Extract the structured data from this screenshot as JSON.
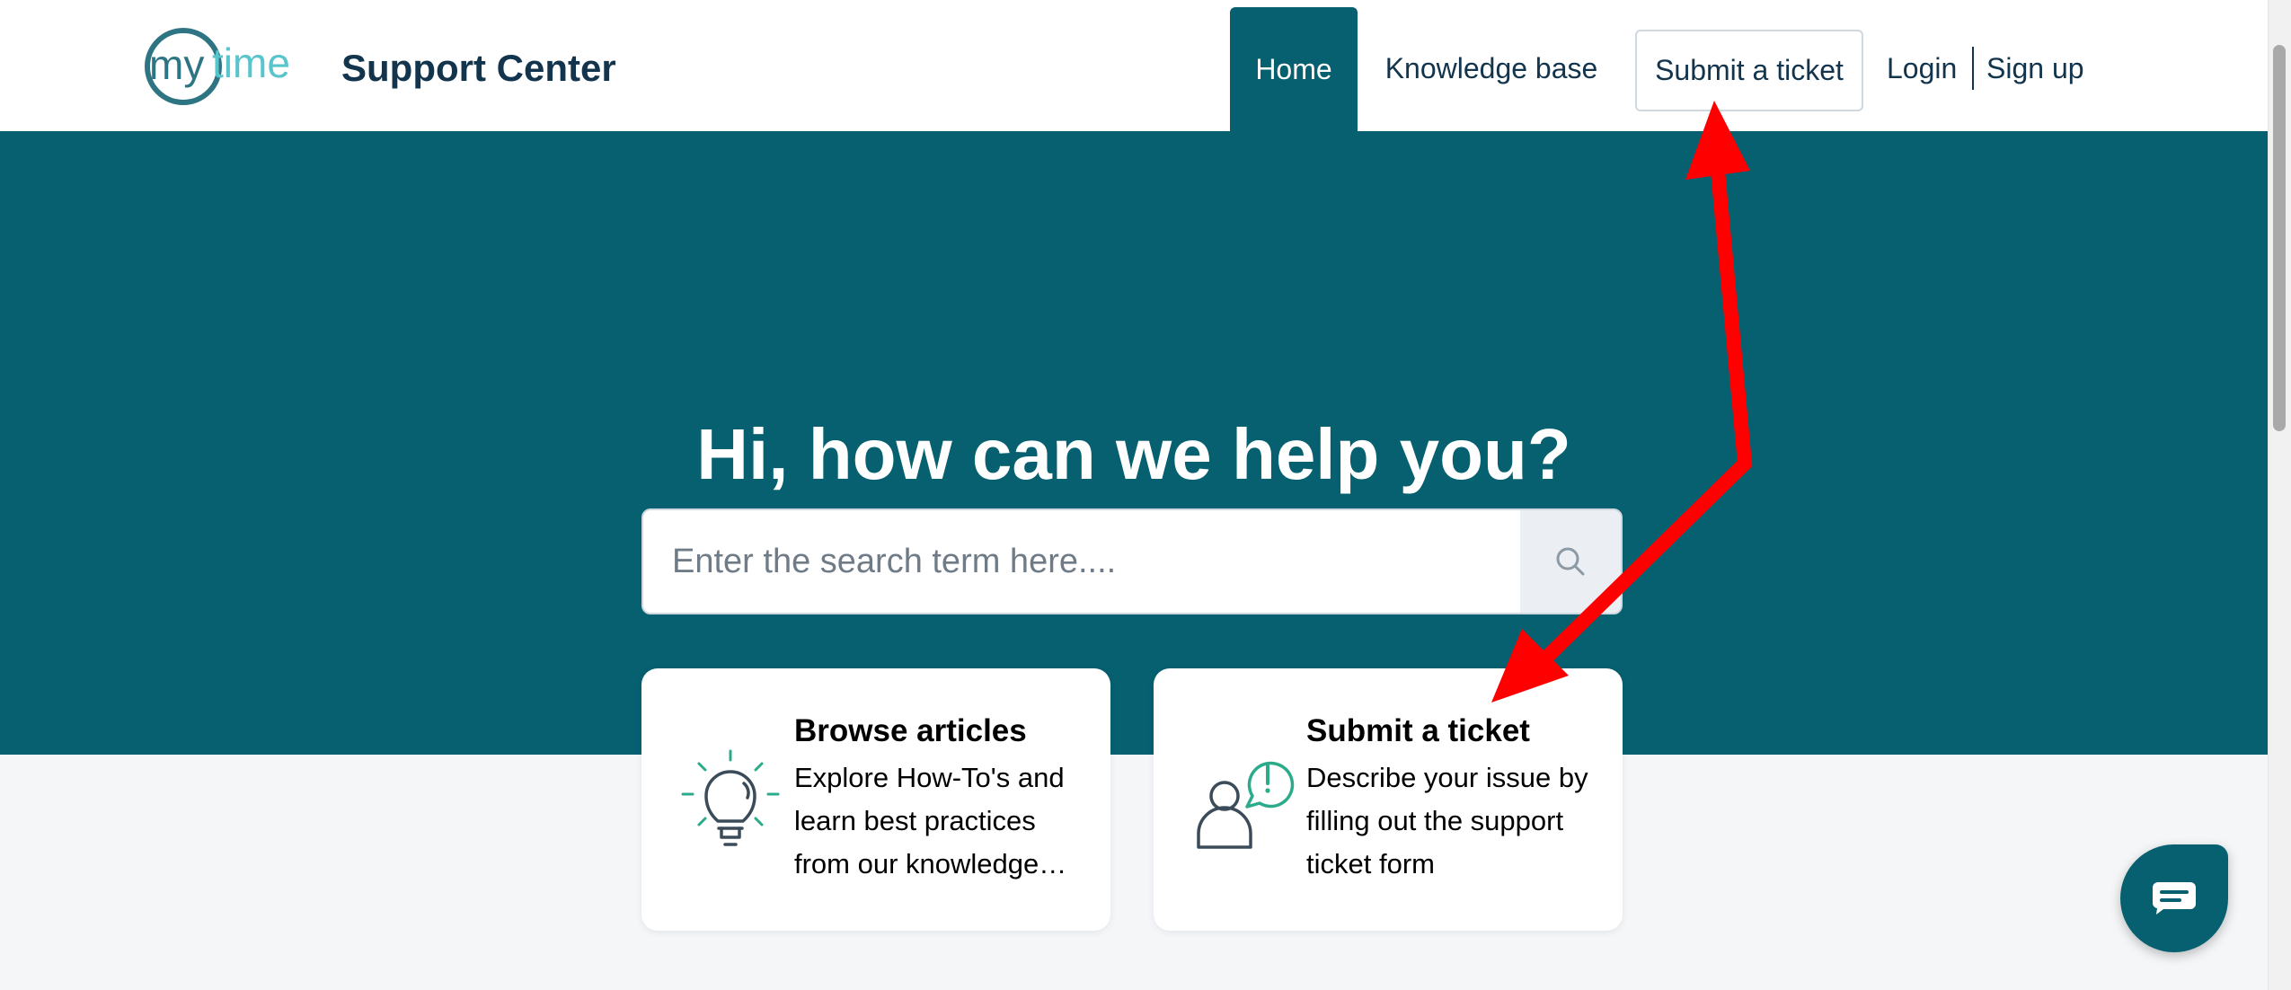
{
  "header": {
    "logo_text": "mytime",
    "brand_title": "Support Center",
    "nav": {
      "home": "Home",
      "knowledge_base": "Knowledge base",
      "submit_ticket": "Submit a ticket",
      "login": "Login",
      "signup": "Sign up"
    }
  },
  "hero": {
    "title": "Hi, how can we help you?",
    "search": {
      "placeholder": "Enter the search term here...."
    }
  },
  "cards": [
    {
      "title": "Browse articles",
      "description": "Explore How-To's and learn best practices from our knowledge base",
      "icon": "lightbulb-icon"
    },
    {
      "title": "Submit a ticket",
      "description": "Describe your issue by filling out the support ticket form",
      "icon": "user-alert-icon"
    }
  ],
  "chat": {
    "icon": "chat-icon"
  },
  "colors": {
    "primary": "#066070",
    "accent_green": "#2cab8b",
    "logo_teal": "#2e7584",
    "logo_light": "#58c4cc",
    "annotation_red": "#ff0000",
    "page_bg": "#f5f6f8"
  }
}
